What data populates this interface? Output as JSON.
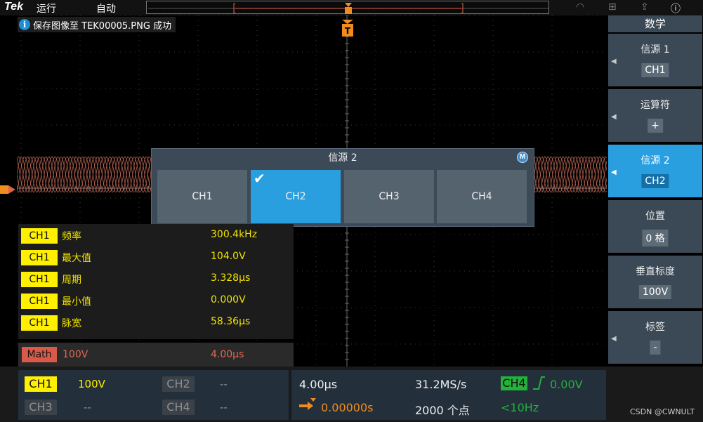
{
  "topbar": {
    "brand": "Tek",
    "run_state": "运行",
    "trigger_mode": "自动",
    "icons": [
      "wifi-icon",
      "network-icon",
      "export-icon",
      "help-icon"
    ]
  },
  "info_message": "保存图像至 TEK00005.PNG 成功",
  "popup": {
    "title": "信源 2",
    "badge": "M",
    "options": [
      "CH1",
      "CH2",
      "CH3",
      "CH4"
    ],
    "selected": "CH2"
  },
  "measurements": [
    {
      "channel": "CH1",
      "name": "频率",
      "value": "300.4kHz"
    },
    {
      "channel": "CH1",
      "name": "最大值",
      "value": "104.0V"
    },
    {
      "channel": "CH1",
      "name": "周期",
      "value": "3.328µs"
    },
    {
      "channel": "CH1",
      "name": "最小值",
      "value": "0.000V"
    },
    {
      "channel": "CH1",
      "name": "脉宽",
      "value": "58.36µs"
    }
  ],
  "math_bar": {
    "label": "Math",
    "scale": "100V",
    "time": "4.00µs"
  },
  "channels": {
    "ch1": {
      "label": "CH1",
      "value": "100V"
    },
    "ch2": {
      "label": "CH2",
      "value": "--"
    },
    "ch3": {
      "label": "CH3",
      "value": "--"
    },
    "ch4": {
      "label": "CH4",
      "value": "--"
    }
  },
  "horizontal": {
    "timebase": "4.00µs",
    "sample_rate": "31.2MS/s",
    "trigger_position": "0.00000s",
    "record_length": "2000 个点",
    "trigger_source": "CH4",
    "trigger_level": "0.00V",
    "trigger_freq": "<10Hz"
  },
  "side_menu": {
    "title": "数学",
    "items": [
      {
        "label": "信源 1",
        "value": "CH1"
      },
      {
        "label": "运算符",
        "value": "+"
      },
      {
        "label": "信源 2",
        "value": "CH2"
      },
      {
        "label": "位置",
        "value": "0 格"
      },
      {
        "label": "垂直标度",
        "value": "100V"
      },
      {
        "label": "标签",
        "value": "-"
      }
    ],
    "active_index": 2
  },
  "watermark": "CSDN @CWNULT",
  "colors": {
    "ch1": "#ffef00",
    "math": "#d95a48",
    "ch4": "#22b33a",
    "accent": "#2a9fe0",
    "trigger": "#f08c1e"
  }
}
